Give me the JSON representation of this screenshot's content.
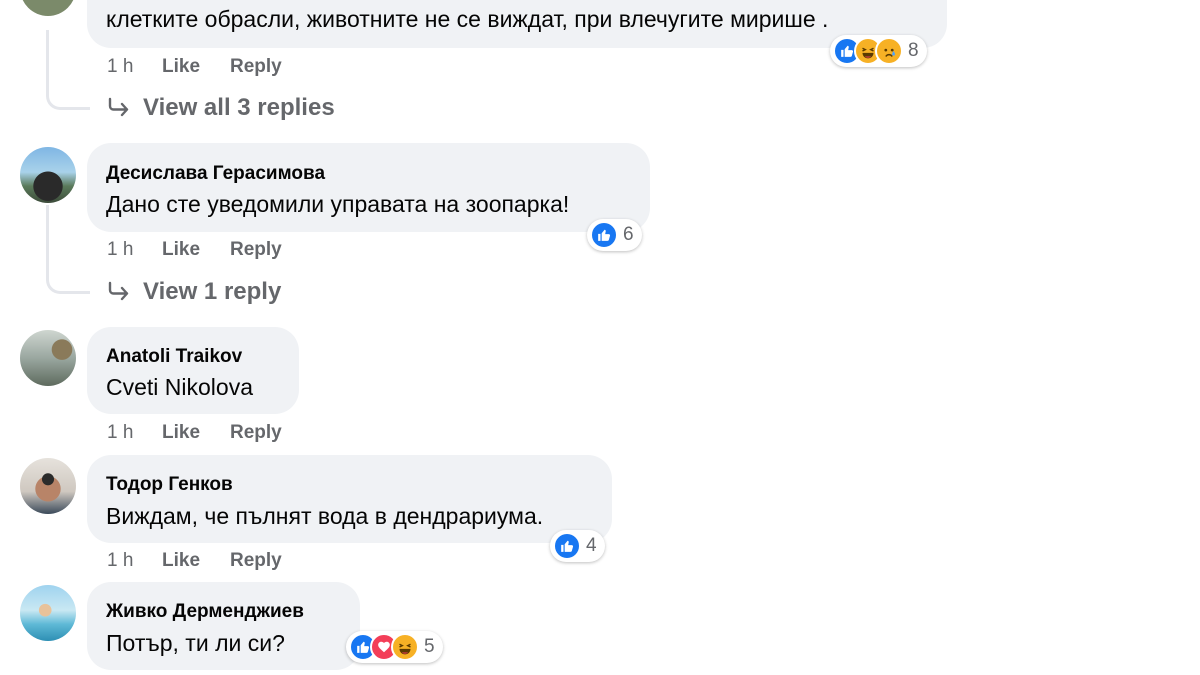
{
  "comments": [
    {
      "text": "клетките обрасли, животните не се виждат, при влечугите мирише .",
      "time": "1 h",
      "like": "Like",
      "reply": "Reply",
      "reactions": [
        "like",
        "haha",
        "sad"
      ],
      "reaction_count": "8",
      "view_replies": "View all 3 replies"
    },
    {
      "author": "Десислава Герасимова",
      "text": "Дано сте уведомили управата на зоопарка!",
      "time": "1 h",
      "like": "Like",
      "reply": "Reply",
      "reactions": [
        "like"
      ],
      "reaction_count": "6",
      "view_replies": "View 1 reply"
    },
    {
      "author": "Anatoli Traikov",
      "text": "Cveti Nikolova",
      "time": "1 h",
      "like": "Like",
      "reply": "Reply"
    },
    {
      "author": "Тодор Генков",
      "text": "Виждам, че пълнят вода в дендрариума.",
      "time": "1 h",
      "like": "Like",
      "reply": "Reply",
      "reactions": [
        "like"
      ],
      "reaction_count": "4"
    },
    {
      "author": "Живко Дерменджиев",
      "text": "Потър, ти ли си?",
      "reactions": [
        "like",
        "love",
        "haha"
      ],
      "reaction_count": "5"
    }
  ],
  "colors": {
    "like": "#1877f2",
    "love": "#f33e58",
    "haha": "#f7b125",
    "sad": "#f7b125",
    "bubble": "#f0f2f5",
    "meta": "#65676b"
  }
}
